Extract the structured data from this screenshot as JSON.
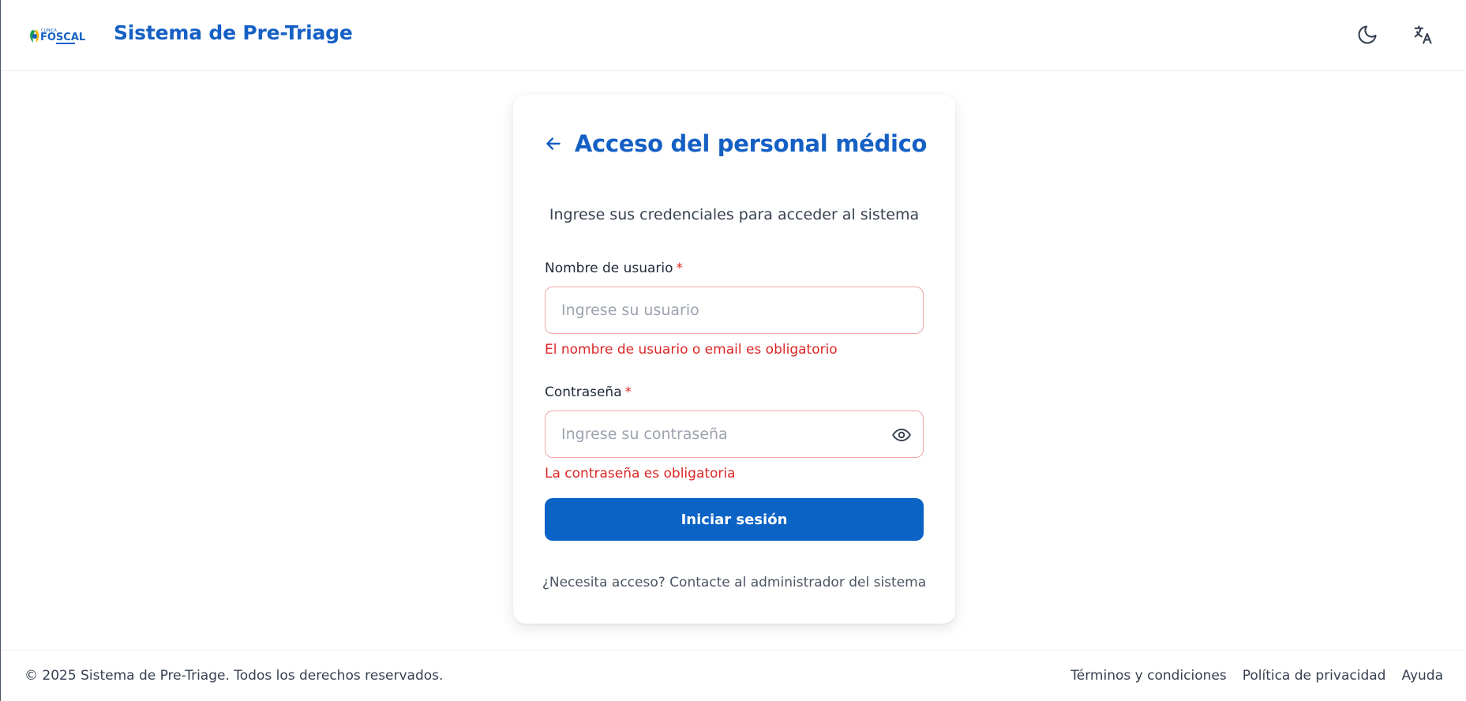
{
  "header": {
    "logo_text": "CLINICA FOSCAL",
    "title": "Sistema de Pre-Triage",
    "theme_icon": "moon-icon",
    "language_icon": "translate-icon"
  },
  "login": {
    "title": "Acceso del personal médico",
    "subtitle": "Ingrese sus credenciales para acceder al sistema",
    "username": {
      "label": "Nombre de usuario",
      "required_mark": "*",
      "placeholder": "Ingrese su usuario",
      "value": "",
      "error": "El nombre de usuario o email es obligatorio"
    },
    "password": {
      "label": "Contraseña",
      "required_mark": "*",
      "placeholder": "Ingrese su contraseña",
      "value": "",
      "error": "La contraseña es obligatoria"
    },
    "submit_label": "Iniciar sesión",
    "help_text": "¿Necesita acceso? Contacte al administrador del sistema"
  },
  "footer": {
    "copyright": "© 2025 Sistema de Pre-Triage. Todos los derechos reservados.",
    "links": [
      "Términos y condiciones",
      "Política de privacidad",
      "Ayuda"
    ]
  },
  "colors": {
    "brand": "#1560c4",
    "button": "#0b63c6",
    "error": "#dc2626",
    "input_error_border": "#f2a6a6"
  }
}
